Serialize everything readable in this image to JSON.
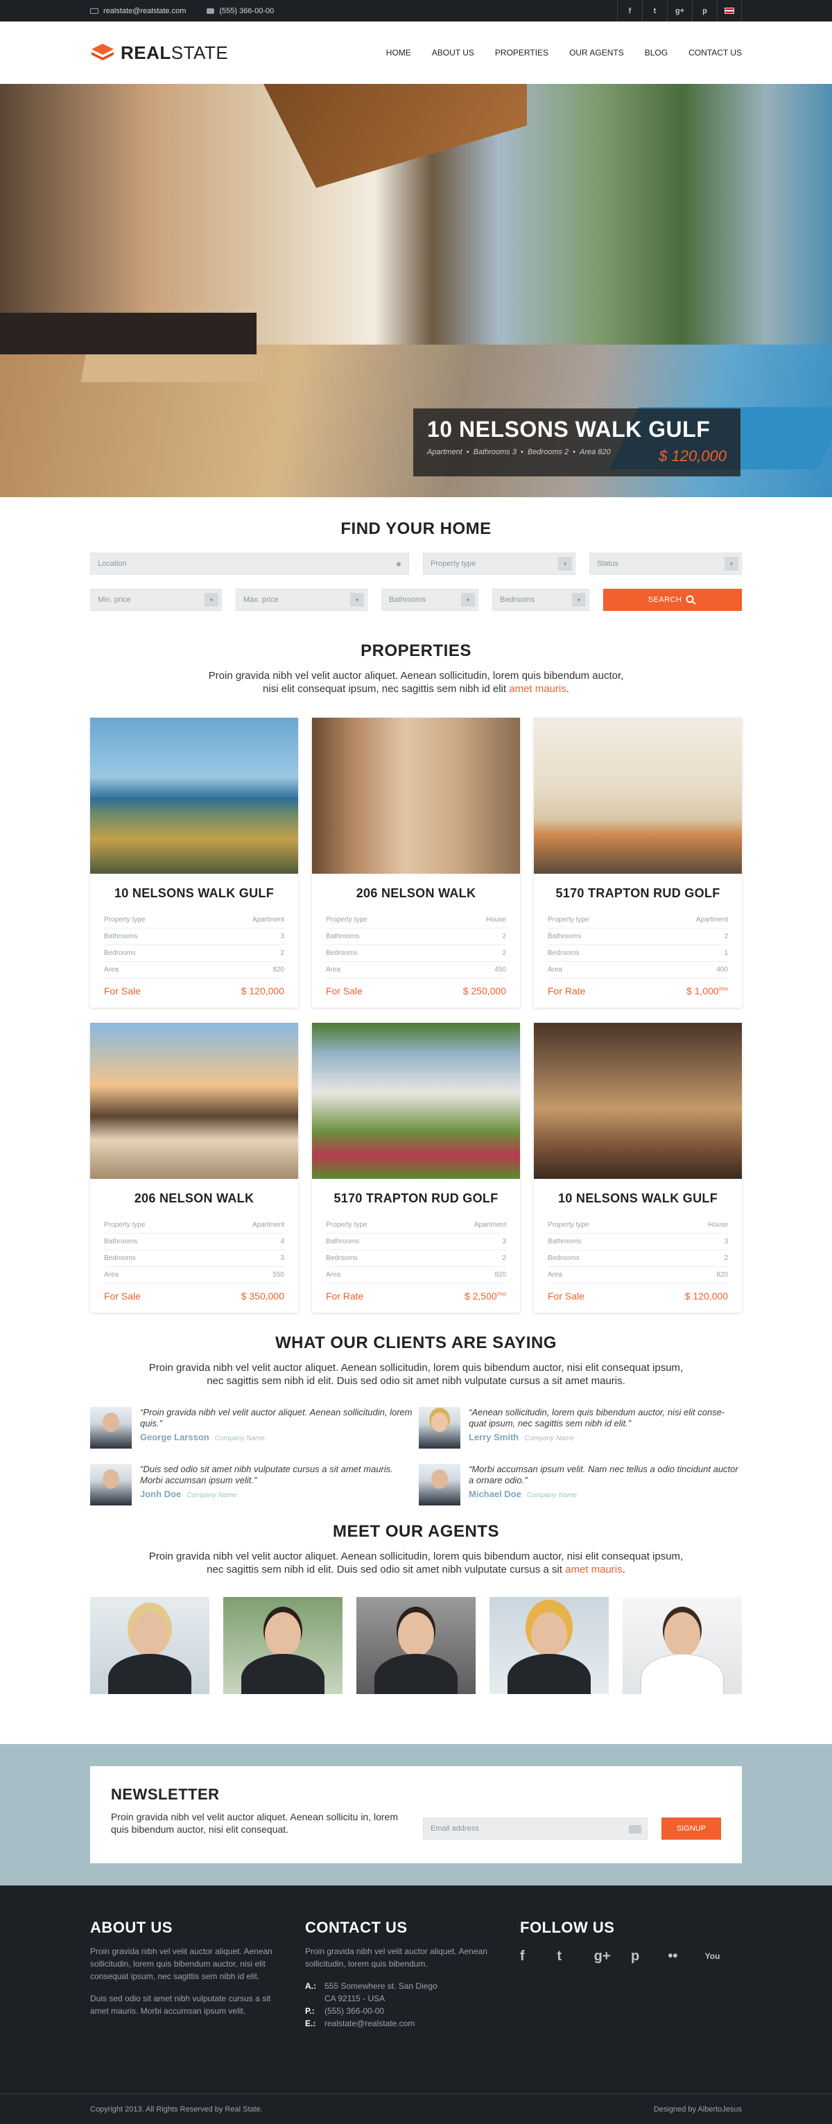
{
  "topbar": {
    "email": "realstate@realstate.com",
    "phone": "(555) 366-00-00",
    "social": [
      "f",
      "t",
      "g+",
      "p"
    ]
  },
  "brand": {
    "logo_bold": "REAL",
    "logo_rest": "STATE",
    "accent": "#f1602d"
  },
  "nav": [
    "HOME",
    "ABOUT US",
    "PROPERTIES",
    "OUR AGENTS",
    "BLOG",
    "CONTACT US"
  ],
  "hero": {
    "title": "10 NELSONS WALK GULF",
    "meta": [
      "Apartment",
      "Bathrooms 3",
      "Bedrooms 2",
      "Area 820"
    ],
    "price": "$ 120,000",
    "slides": 5,
    "active_slide": 2
  },
  "search": {
    "title": "FIND YOUR HOME",
    "location": "Location",
    "property_type": "Property type",
    "status": "Status",
    "min_price": "Min. price",
    "max_price": "Max. price",
    "bathrooms": "Bathrooms",
    "bedrooms": "Bedrooms",
    "button": "SEARCH"
  },
  "properties": {
    "title": "PROPERTIES",
    "lead": "Proin gravida nibh vel velit auctor aliquet. Aenean sollicitudin, lorem quis bibendum auctor,",
    "lead2": "nisi elit consequat ipsum, nec sagittis sem nibh id elit",
    "lead_link": "amet mauris",
    "rows_labels": [
      "Property type",
      "Bathrooms",
      "Bedrooms",
      "Area"
    ],
    "items": [
      {
        "name": "10 NELSONS WALK GULF",
        "type": "Apartment",
        "bath": "3",
        "bed": "2",
        "area": "820",
        "status": "For Sale",
        "price": "$ 120,000",
        "sup": ""
      },
      {
        "name": "206 NELSON WALK",
        "type": "House",
        "bath": "2",
        "bed": "2",
        "area": "450",
        "status": "For Sale",
        "price": "$ 250,000",
        "sup": ""
      },
      {
        "name": "5170 TRAPTON RUD GOLF",
        "type": "Apartment",
        "bath": "2",
        "bed": "1",
        "area": "400",
        "status": "For Rate",
        "price": "$ 1,000",
        "sup": "/mo"
      },
      {
        "name": "206 NELSON WALK",
        "type": "Apartment",
        "bath": "4",
        "bed": "3",
        "area": "550",
        "status": "For Sale",
        "price": "$ 350,000",
        "sup": ""
      },
      {
        "name": "5170 TRAPTON RUD GOLF",
        "type": "Apartment",
        "bath": "3",
        "bed": "2",
        "area": "820",
        "status": "For Rate",
        "price": "$ 2,500",
        "sup": "/mo"
      },
      {
        "name": "10 NELSONS WALK GULF",
        "type": "House",
        "bath": "3",
        "bed": "2",
        "area": "820",
        "status": "For Sale",
        "price": "$ 120,000",
        "sup": ""
      }
    ]
  },
  "testimonials": {
    "title": "WHAT OUR CLIENTS ARE SAYING",
    "lead": "Proin gravida nibh vel velit auctor aliquet. Aenean sollicitudin, lorem quis bibendum auctor, nisi elit consequat ipsum,",
    "lead2": "nec sagittis sem nibh id elit. Duis sed odio sit amet nibh vulputate cursus a sit amet mauris.",
    "items": [
      {
        "text": "“Proin gravida nibh vel velit auctor aliquet. Aenean sollicitudin, lorem quis.”",
        "name": "George Larsson",
        "company": "Company Name"
      },
      {
        "text": "“Aenean sollicitudin, lorem quis bibendum auctor, nisi elit conse-quat ipsum, nec sagittis sem nibh id elit.”",
        "name": "Lerry Smith",
        "company": "Company Name"
      },
      {
        "text": "“Duis sed odio sit amet nibh vulputate cursus a sit amet mauris. Morbi accumsan ipsum velit.”",
        "name": "Jonh Doe",
        "company": "Company Name"
      },
      {
        "text": "“Morbi accumsan ipsum velit. Nam nec tellus a odio tincidunt auctor a ornare odio.”",
        "name": "Michael Doe",
        "company": "Company Name"
      }
    ]
  },
  "agents": {
    "title": "MEET OUR AGENTS",
    "lead": "Proin gravida nibh vel velit auctor aliquet. Aenean sollicitudin, lorem quis bibendum auctor, nisi elit consequat ipsum,",
    "lead2": "nec sagittis sem nibh id elit. Duis sed odio sit amet nibh vulputate cursus a sit",
    "lead_link": "amet mauris"
  },
  "newsletter": {
    "title": "NEWSLETTER",
    "text": "Proin gravida nibh vel velit auctor aliquet. Aenean sollicitu in, lorem quis bibendum auctor, nisi elit consequat.",
    "placeholder": "Email address",
    "button": "SIGNUP"
  },
  "footer": {
    "about_title": "ABOUT US",
    "about_p1": "Proin gravida nibh vel velit auctor aliquet. Aenean sollicitudin, lorem quis bibendum auctor, nisi elit consequat ipsum, nec sagittis sem nibh id elit.",
    "about_p2": "Duis sed odio sit amet nibh vulputate cursus a sit amet mauris. Morbi accumsan ipsum velit.",
    "contact_title": "CONTACT US",
    "contact_p": "Proin gravida nibh vel velit auctor aliquet. Aenean sollicitudin, lorem quis bibendum.",
    "addr_label": "A.:",
    "addr1": "555 Somewhere st. San Diego",
    "addr2": "CA 92115 - USA",
    "phone_label": "P.:",
    "phone": "(555) 366-00-00",
    "email_label": "E.:",
    "email": "realstate@realstate.com",
    "follow_title": "FOLLOW US",
    "social": [
      "f",
      "t",
      "g+",
      "p",
      "••",
      "You"
    ],
    "copyright": "Copyright 2013. All Rights Reserved by Real State.",
    "designer": "Designed by AlbertoJesus"
  }
}
